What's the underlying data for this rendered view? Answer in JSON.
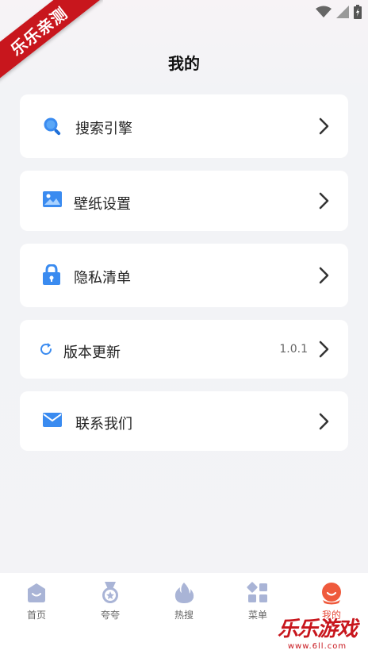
{
  "badge": "乐乐亲测",
  "header": {
    "title": "我的"
  },
  "menu": [
    {
      "label": "搜索引擎",
      "icon": "search-icon"
    },
    {
      "label": "壁纸设置",
      "icon": "image-icon"
    },
    {
      "label": "隐私清单",
      "icon": "lock-icon"
    },
    {
      "label": "版本更新",
      "icon": "refresh-icon",
      "value": "1.0.1"
    },
    {
      "label": "联系我们",
      "icon": "mail-icon"
    }
  ],
  "tabs": [
    {
      "label": "首页",
      "icon": "home-icon",
      "active": false
    },
    {
      "label": "夸夸",
      "icon": "medal-icon",
      "active": false
    },
    {
      "label": "热搜",
      "icon": "flame-icon",
      "active": false
    },
    {
      "label": "菜单",
      "icon": "grid-icon",
      "active": false
    },
    {
      "label": "我的",
      "icon": "profile-icon",
      "active": true
    }
  ],
  "watermark": {
    "name": "乐乐游戏",
    "url": "www.6ll.com"
  },
  "colors": {
    "accent": "#1e88e5",
    "active": "#e74c3c",
    "ribbon": "#c8161d"
  }
}
